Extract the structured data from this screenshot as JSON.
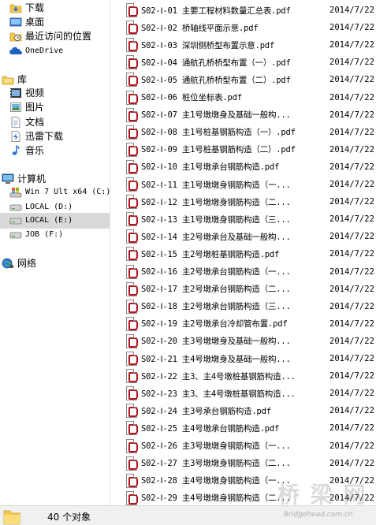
{
  "nav": {
    "favorites": [
      {
        "label": "下载",
        "icon": "downloads-folder-icon"
      },
      {
        "label": "桌面",
        "icon": "desktop-icon"
      },
      {
        "label": "最近访问的位置",
        "icon": "recent-places-icon"
      },
      {
        "label": "OneDrive",
        "icon": "onedrive-cloud-icon"
      }
    ],
    "libraries": {
      "label": "库",
      "items": [
        {
          "label": "视频",
          "icon": "video-library-icon"
        },
        {
          "label": "图片",
          "icon": "pictures-library-icon"
        },
        {
          "label": "文档",
          "icon": "documents-library-icon"
        },
        {
          "label": "迅雷下载",
          "icon": "thunder-download-icon"
        },
        {
          "label": "音乐",
          "icon": "music-library-icon"
        }
      ]
    },
    "computer": {
      "label": "计算机",
      "drives": [
        {
          "label": "Win 7 Ult x64 (C:)",
          "icon": "system-drive-icon"
        },
        {
          "label": "LOCAL (D:)",
          "icon": "hard-drive-icon"
        },
        {
          "label": "LOCAL (E:)",
          "icon": "hard-drive-icon",
          "selected": true
        },
        {
          "label": "JOB (F:)",
          "icon": "hard-drive-icon"
        }
      ]
    },
    "network": {
      "label": "网络",
      "icon": "network-icon"
    }
  },
  "files": [
    {
      "name": "S02-Ⅰ-01 主要工程材料数量汇总表.pdf",
      "date": "2014/7/22"
    },
    {
      "name": "S02-Ⅰ-02 桥轴线平面示意.pdf",
      "date": "2014/7/22"
    },
    {
      "name": "S02-Ⅰ-03 深圳侧桥型布置示意.pdf",
      "date": "2014/7/22"
    },
    {
      "name": "S02-Ⅰ-04 通航孔桥桥型布置（一）.pdf",
      "date": "2014/7/22"
    },
    {
      "name": "S02-Ⅰ-05 通航孔桥桥型布置（二）.pdf",
      "date": "2014/7/22"
    },
    {
      "name": "S02-Ⅰ-06 桩位坐标表.pdf",
      "date": "2014/7/22"
    },
    {
      "name": "S02-Ⅰ-07 主1号墩墩身及基础一般构...",
      "date": "2014/7/22"
    },
    {
      "name": "S02-Ⅰ-08 主1号桩基钢筋构造（一）.pdf",
      "date": "2014/7/22"
    },
    {
      "name": "S02-Ⅰ-09 主1号桩基钢筋构造（二）.pdf",
      "date": "2014/7/22"
    },
    {
      "name": "S02-Ⅰ-10 主1号墩承台钢筋构造.pdf",
      "date": "2014/7/22"
    },
    {
      "name": "S02-Ⅰ-11 主1号墩墩身钢筋构造（一...",
      "date": "2014/7/22"
    },
    {
      "name": "S02-Ⅰ-12 主1号墩墩身钢筋构造（二...",
      "date": "2014/7/22"
    },
    {
      "name": "S02-Ⅰ-13 主1号墩墩身钢筋构造（三...",
      "date": "2014/7/22"
    },
    {
      "name": "S02-Ⅰ-14 主2号墩承台及基础一般构...",
      "date": "2014/7/22"
    },
    {
      "name": "S02-Ⅰ-15 主2号墩桩基钢筋构造.pdf",
      "date": "2014/7/22"
    },
    {
      "name": "S02-Ⅰ-16 主2号墩承台钢筋构造（一...",
      "date": "2014/7/22"
    },
    {
      "name": "S02-Ⅰ-17 主2号墩承台钢筋构造（二...",
      "date": "2014/7/22"
    },
    {
      "name": "S02-Ⅰ-18 主2号墩承台钢筋构造（三...",
      "date": "2014/7/22"
    },
    {
      "name": "S02-Ⅰ-19 主2号墩承台冷却管布置.pdf",
      "date": "2014/7/22"
    },
    {
      "name": "S02-Ⅰ-20 主3号墩墩身及基础一般构...",
      "date": "2014/7/22"
    },
    {
      "name": "S02-Ⅰ-21 主4号墩墩身及基础一般构...",
      "date": "2014/7/22"
    },
    {
      "name": "S02-Ⅰ-22 主3、主4号墩桩基钢筋构造...",
      "date": "2014/7/22"
    },
    {
      "name": "S02-Ⅰ-23 主3、主4号墩桩基钢筋构造...",
      "date": "2014/7/22"
    },
    {
      "name": "S02-Ⅰ-24 主3号承台钢筋构造.pdf",
      "date": "2014/7/22"
    },
    {
      "name": "S02-Ⅰ-25 主4号墩承台钢筋构造.pdf",
      "date": "2014/7/22"
    },
    {
      "name": "S02-Ⅰ-26 主3号墩墩身钢筋构造（一...",
      "date": "2014/7/22"
    },
    {
      "name": "S02-Ⅰ-27 主3号墩墩身钢筋构造（二...",
      "date": "2014/7/22"
    },
    {
      "name": "S02-Ⅰ-28 主4号墩墩身钢筋构造（一...",
      "date": "2014/7/22"
    },
    {
      "name": "S02-Ⅰ-29 主4号墩墩身钢筋构造（二...",
      "date": "2014/7/22"
    }
  ],
  "status": {
    "count_text": "40 个对象"
  },
  "watermark": {
    "text_cn": "桥 梁 网",
    "url": "Bridgehead.com.cn"
  },
  "colors": {
    "selected_bg": "#d9d9d9",
    "pdf_red": "#b5121b",
    "status_bg": "#f0f0f0"
  }
}
